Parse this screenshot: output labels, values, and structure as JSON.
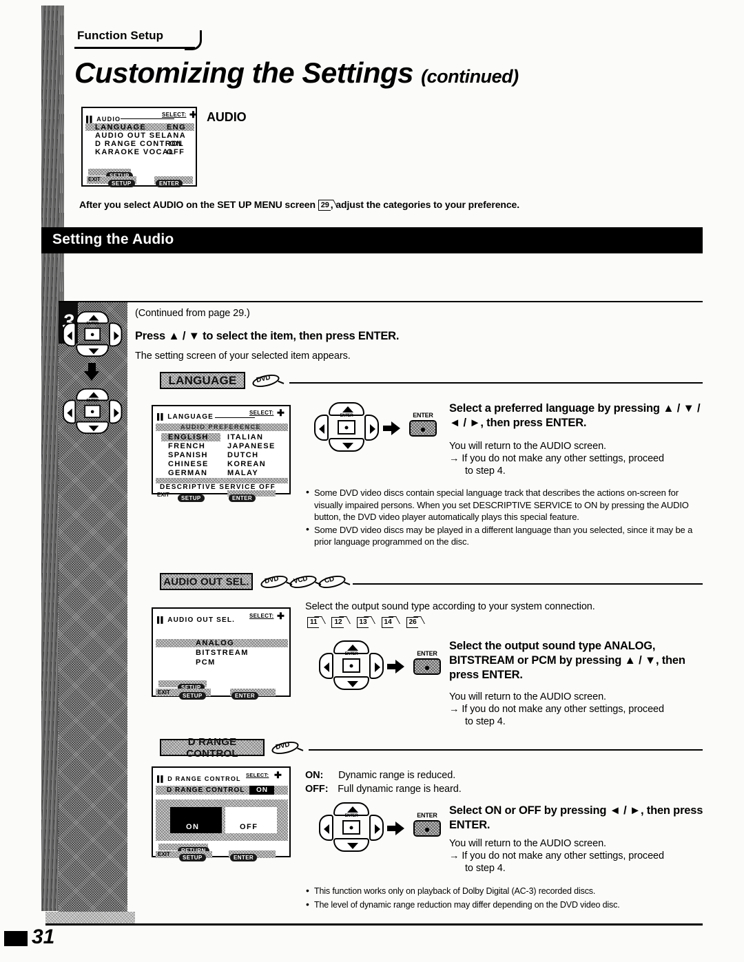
{
  "header": {
    "eyebrow": "Function Setup",
    "title": "Customizing the Settings",
    "title_suffix": "(continued)"
  },
  "audio_menu_screen": {
    "title": "AUDIO",
    "select_label": "SELECT:",
    "rows": [
      {
        "name": "LANGUAGE",
        "value": "ENG",
        "highlighted": true
      },
      {
        "name": "AUDIO OUT SEL.",
        "value": "ANA",
        "highlighted": false
      },
      {
        "name": "D RANGE CONTROL",
        "value": "ON",
        "highlighted": false
      },
      {
        "name": "KARAOKE VOCAL",
        "value": "OFF",
        "highlighted": false
      }
    ],
    "footer_keys": [
      "SETUP",
      "EXIT",
      "SETUP",
      "ENTER"
    ]
  },
  "audio_screen_side_label": "AUDIO",
  "intro_text_before": "After you select AUDIO on the SET UP MENU screen ",
  "intro_pageref": "29",
  "intro_text_after": ", adjust the categories to your preference.",
  "section_bar": "Setting the Audio",
  "step": {
    "number": "3",
    "continued_note": "(Continued from page 29.)",
    "instruction": "Press ▲ / ▼ to select the item, then press ENTER.",
    "sub_note": "The setting screen of your selected item appears."
  },
  "sections": [
    {
      "tag": "LANGUAGE",
      "discs": [
        "DVD"
      ],
      "screen": {
        "title": "LANGUAGE",
        "select_label": "SELECT:",
        "band_label": "AUDIO PREFERENCE",
        "left_column": [
          "ENGLISH",
          "FRENCH",
          "SPANISH",
          "CHINESE",
          "GERMAN"
        ],
        "right_column": [
          "ITALIAN",
          "JAPANESE",
          "DUTCH",
          "KOREAN",
          "MALAY"
        ],
        "selected": "ENGLISH",
        "descriptive_service": "DESCRIPTIVE SERVICE OFF",
        "footer_keys": [
          "EXIT",
          "SETUP",
          "ENTER"
        ]
      },
      "enter_label": "ENTER",
      "heading": "Select a preferred language by pressing ▲ / ▼ / ◄ / ►, then press ENTER.",
      "body1": "You will return to the AUDIO screen.",
      "body2": "→ If you do not make any other settings, proceed",
      "body3": "to step 4.",
      "bullets": [
        "Some DVD video discs contain special language track that describes the actions on-screen for visually impaired persons.  When you set DESCRIPTIVE SERVICE to ON by pressing the AUDIO button, the DVD video player automatically plays this special feature.",
        "Some DVD video discs may be played in a different language than you selected, since it may be a prior language programmed on the disc."
      ]
    },
    {
      "tag": "AUDIO OUT SEL.",
      "discs": [
        "DVD",
        "VCD",
        "CD"
      ],
      "screen": {
        "title": "AUDIO OUT SEL.",
        "select_label": "SELECT:",
        "options": [
          "ANALOG",
          "BITSTREAM",
          "PCM"
        ],
        "selected": "ANALOG",
        "footer_keys": [
          "SETUP",
          "EXIT",
          "SETUP",
          "ENTER"
        ]
      },
      "lead_text": "Select the output sound type according to your system connection.",
      "pagerefs": [
        "11",
        "12",
        "13",
        "14",
        "26"
      ],
      "enter_label": "ENTER",
      "heading": "Select the output sound type ANALOG, BITSTREAM or PCM by pressing ▲ / ▼, then press ENTER.",
      "body1": "You will return to the AUDIO screen.",
      "body2": "→ If you do not make any other settings, proceed",
      "body3": "to step 4."
    },
    {
      "tag": "D RANGE CONTROL",
      "discs": [
        "DVD"
      ],
      "screen": {
        "title": "D RANGE CONTROL",
        "select_label": "SELECT:",
        "band_label": "D RANGE CONTROL",
        "band_value": "ON",
        "choices": [
          "ON",
          "OFF"
        ],
        "selected": "ON",
        "footer_keys": [
          "RETURN",
          "EXIT",
          "SETUP",
          "ENTER"
        ]
      },
      "on_label": "ON:",
      "on_text": "Dynamic range is reduced.",
      "off_label": "OFF:",
      "off_text": "Full dynamic range is heard.",
      "enter_label": "ENTER",
      "heading": "Select ON or OFF by pressing ◄ / ►, then press ENTER.",
      "body1": "You will return to the AUDIO screen.",
      "body2": "→ If you do not make any other settings, proceed",
      "body3": "to step 4.",
      "bullets": [
        "This function works only on playback of Dolby Digital (AC-3) recorded discs.",
        "The level of dynamic range reduction may differ depending on the DVD video disc."
      ]
    }
  ],
  "footer": {
    "page_number": "31"
  }
}
